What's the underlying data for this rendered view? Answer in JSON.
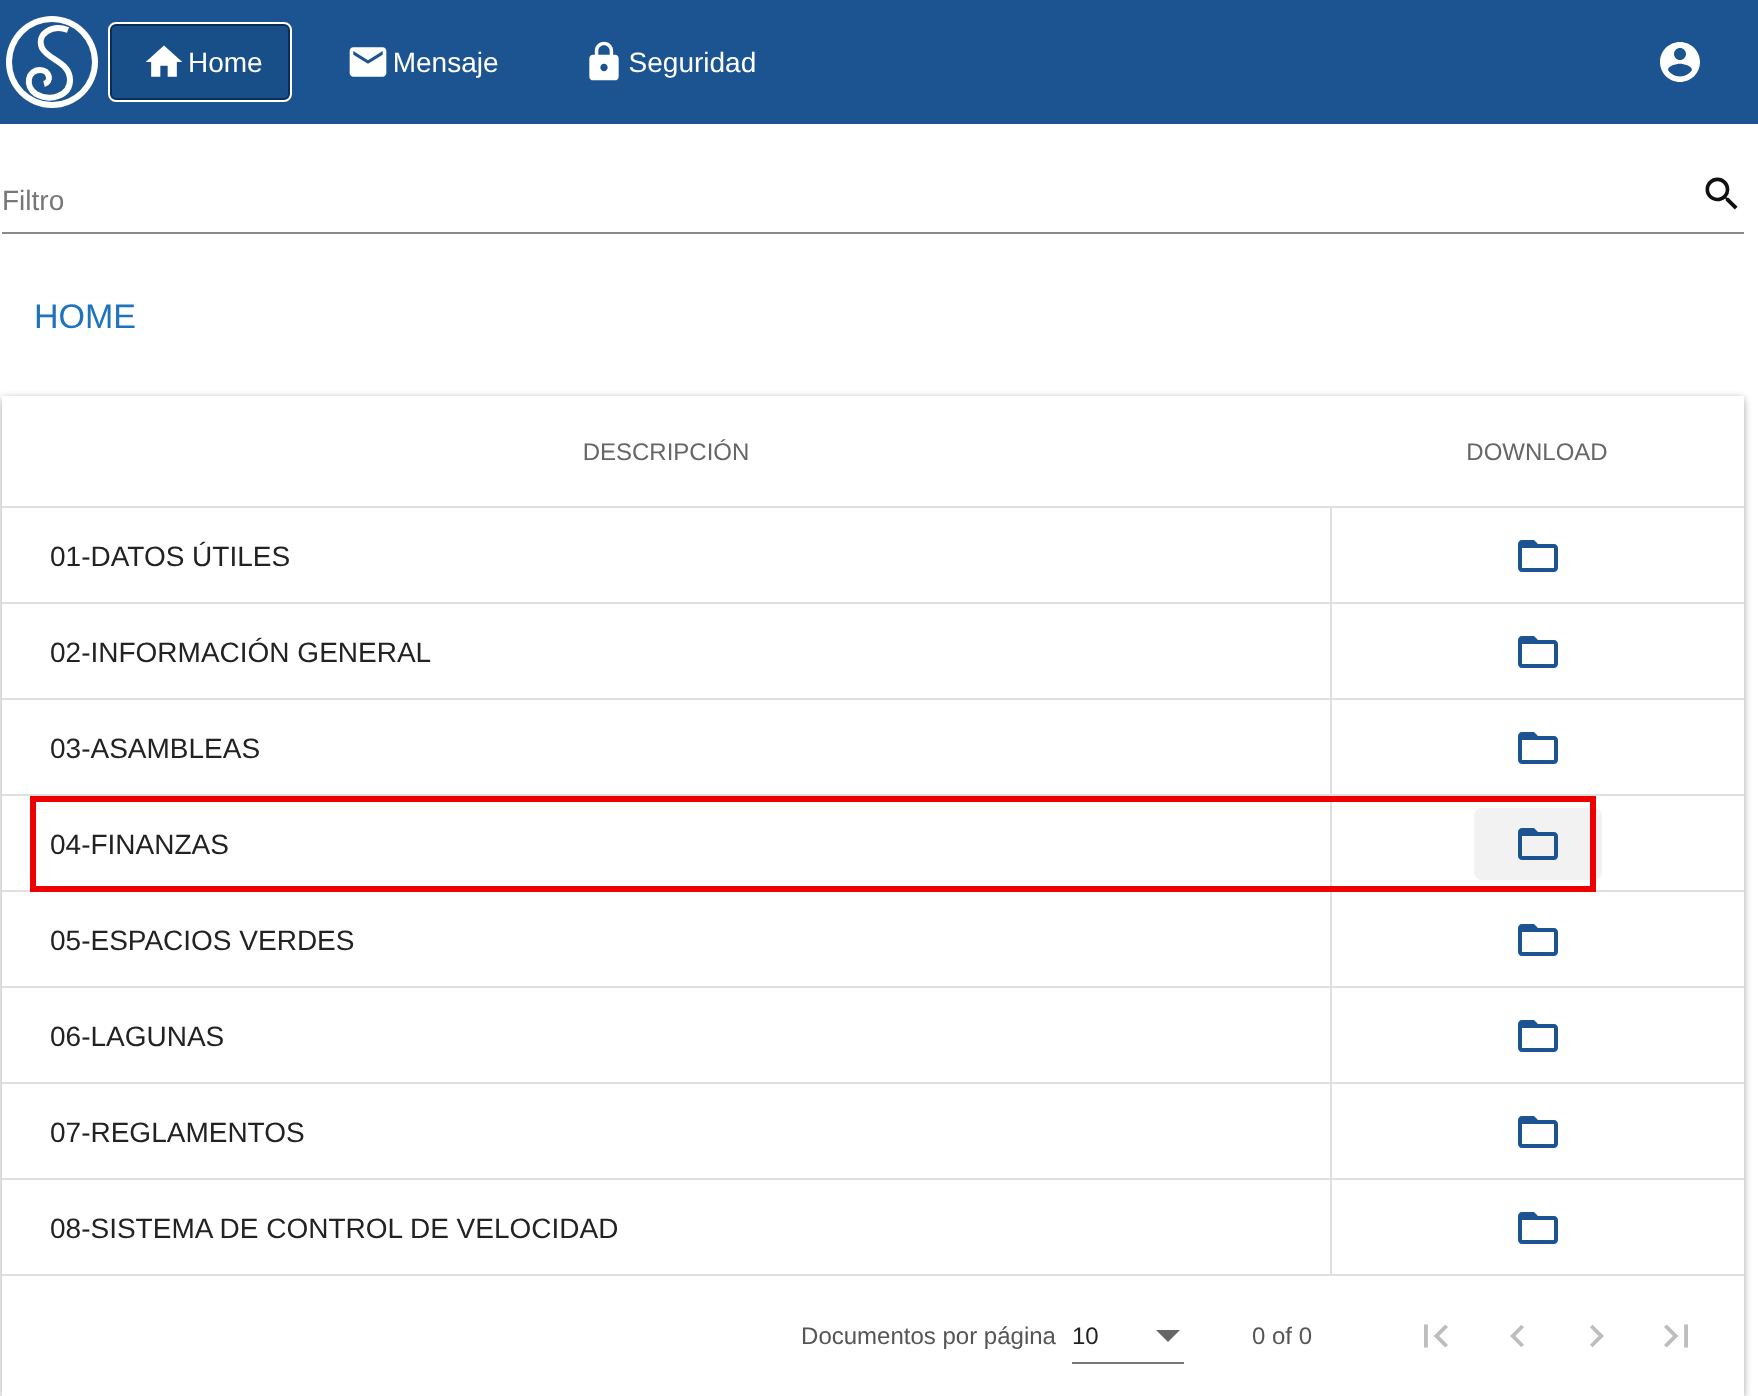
{
  "nav": {
    "items": [
      {
        "label": "Home",
        "selected": true
      },
      {
        "label": "Mensaje",
        "selected": false
      },
      {
        "label": "Seguridad",
        "selected": false
      }
    ]
  },
  "filter": {
    "placeholder": "Filtro"
  },
  "page_title": "HOME",
  "table": {
    "columns": [
      "DESCRIPCIÓN",
      "DOWNLOAD"
    ],
    "rows": [
      {
        "description": "01-DATOS ÚTILES",
        "highlighted": false
      },
      {
        "description": "02-INFORMACIÓN GENERAL",
        "highlighted": false
      },
      {
        "description": "03-ASAMBLEAS",
        "highlighted": false
      },
      {
        "description": "04-FINANZAS",
        "highlighted": true
      },
      {
        "description": "05-ESPACIOS VERDES",
        "highlighted": false
      },
      {
        "description": "06-LAGUNAS",
        "highlighted": false
      },
      {
        "description": "07-REGLAMENTOS",
        "highlighted": false
      },
      {
        "description": "08-SISTEMA DE CONTROL DE VELOCIDAD",
        "highlighted": false
      }
    ]
  },
  "paginator": {
    "label": "Documentos por página",
    "page_size": "10",
    "range": "0 of 0"
  }
}
